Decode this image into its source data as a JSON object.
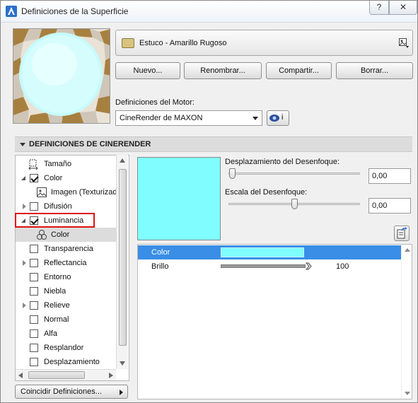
{
  "window": {
    "title": "Definiciones de la Superficie",
    "help_label": "?",
    "close_label": "✕"
  },
  "material": {
    "name": "Estuco - Amarillo Rugoso",
    "swatch_color": "#d8c27c"
  },
  "buttons": {
    "new": "Nuevo...",
    "rename": "Renombrar...",
    "share": "Compartir...",
    "delete": "Borrar..."
  },
  "engine": {
    "label": "Definiciones del Motor:",
    "selected": "CineRender de MAXON",
    "info_label": "i"
  },
  "section": {
    "title": "DEFINICIONES DE CINERENDER"
  },
  "tree": {
    "items": [
      {
        "label": "Tamaño",
        "icon": "size-icon"
      },
      {
        "label": "Color",
        "checked": true,
        "expanded": true
      },
      {
        "label": "Imagen (Texturizado)",
        "icon": "image-icon"
      },
      {
        "label": "Difusión",
        "checked": false,
        "expandable": true
      },
      {
        "label": "Luminancia",
        "checked": true,
        "expanded": true
      },
      {
        "label": "Color",
        "icon": "color-channels-icon",
        "selected": true
      },
      {
        "label": "Transparencia",
        "checked": false
      },
      {
        "label": "Reflectancia",
        "checked": false,
        "expandable": true
      },
      {
        "label": "Entorno",
        "checked": false
      },
      {
        "label": "Niebla",
        "checked": false
      },
      {
        "label": "Relieve",
        "checked": false,
        "expandable": true
      },
      {
        "label": "Normal",
        "checked": false
      },
      {
        "label": "Alfa",
        "checked": false
      },
      {
        "label": "Resplandor",
        "checked": false
      },
      {
        "label": "Desplazamiento",
        "checked": false
      }
    ]
  },
  "match_button": "Coincidir Definiciones...",
  "blur": {
    "offset_label": "Desplazamiento del Desenfoque:",
    "offset_value": "0,00",
    "offset_slider": 0.0,
    "scale_label": "Escala del Desenfoque:",
    "scale_value": "0,00",
    "scale_slider": 0.5
  },
  "luminance_color": "#80feff",
  "params": {
    "rows": [
      {
        "label": "Color",
        "selected": true
      },
      {
        "label": "Brillo",
        "value": "100"
      }
    ],
    "brightness_percent": 100
  },
  "accent_color": "#3a8ee6",
  "highlight_color": "#e01010"
}
